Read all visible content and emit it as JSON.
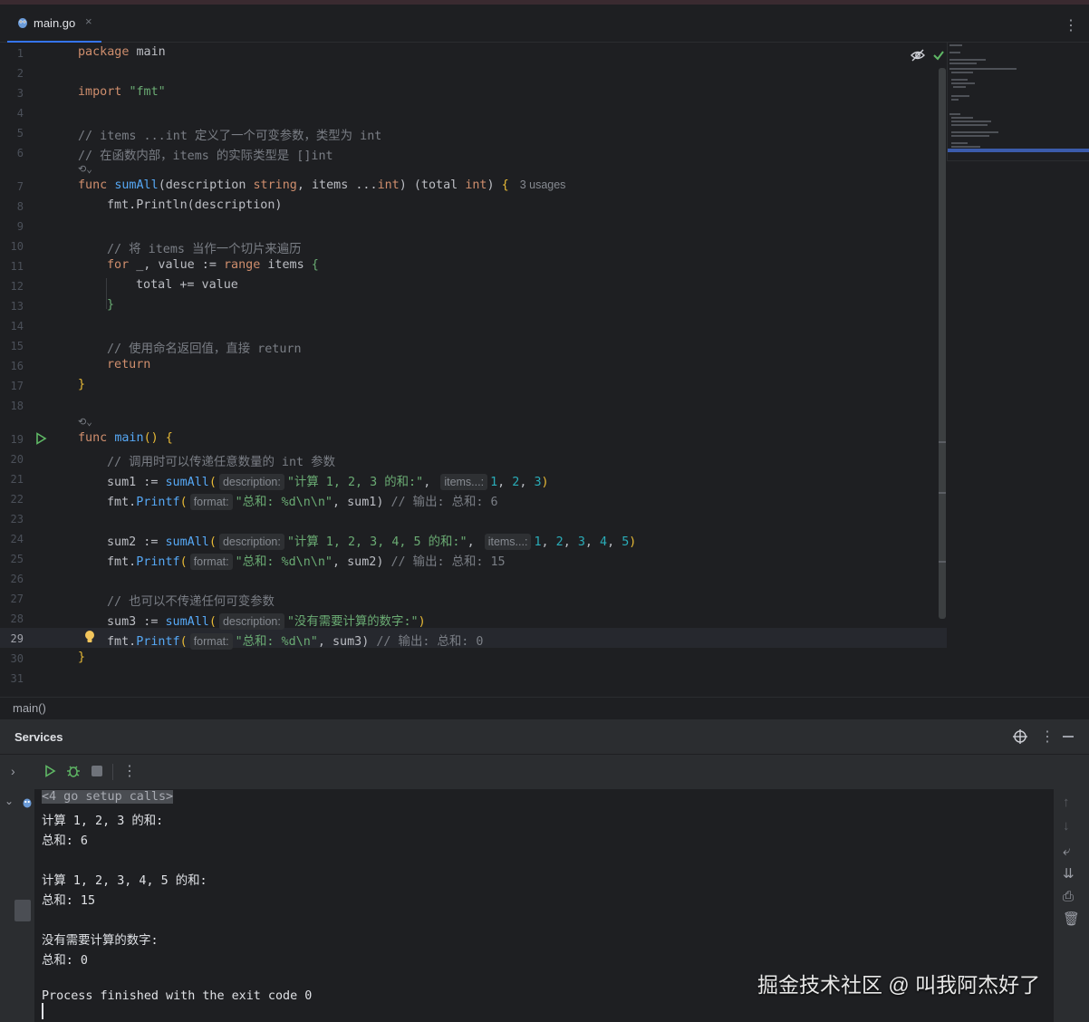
{
  "tab": {
    "filename": "main.go",
    "close": "×",
    "more": "⋮"
  },
  "editor": {
    "line_numbers": [
      "1",
      "2",
      "3",
      "4",
      "5",
      "6",
      "7",
      "8",
      "9",
      "10",
      "11",
      "12",
      "13",
      "14",
      "15",
      "16",
      "17",
      "18",
      "19",
      "20",
      "21",
      "22",
      "23",
      "24",
      "25",
      "26",
      "27",
      "28",
      "29",
      "30",
      "31"
    ],
    "current_line": "29",
    "l1": [
      "package",
      "main"
    ],
    "l3": [
      "import",
      "\"fmt\""
    ],
    "l5": "// items ...int 定义了一个可变参数，类型为 int",
    "l6": "// 在函数内部，items 的实际类型是 []int",
    "l7": {
      "func": "func",
      "name": "sumAll",
      "p1": "(description ",
      "t1": "string",
      "p2": ", items ...",
      "t2": "int",
      "p3": ") (total ",
      "t3": "int",
      "p4": ") ",
      "brace": "{",
      "usages": "3 usages"
    },
    "l8": "fmt.Println(description)",
    "l10": "// 将 items 当作一个切片来遍历",
    "l11": {
      "for": "for",
      "mid": " _, value := ",
      "range": "range",
      "rest": " items ",
      "brace": "{"
    },
    "l12": "total += value",
    "l13": "}",
    "l15": "// 使用命名返回值，直接 return",
    "l16": "return",
    "l17": "}",
    "l19": {
      "func": "func",
      "name": "main",
      "paren": "()",
      "brace": "{"
    },
    "l20": "// 调用时可以传递任意数量的 int 参数",
    "l21": {
      "lhs": "sum1 := ",
      "fn": "sumAll",
      "hint1": "description:",
      "str": "\"计算 1, 2, 3 的和:\"",
      "hint2": "items...:",
      "nums": [
        "1",
        "2",
        "3"
      ],
      "close": ")"
    },
    "l22": {
      "pkg": "fmt.",
      "fn": "Printf",
      "hint": "format:",
      "str": "\"总和: %d\\n\\n\"",
      "rest": ", sum1) ",
      "comment": "// 输出: 总和: 6"
    },
    "l24": {
      "lhs": "sum2 := ",
      "fn": "sumAll",
      "hint1": "description:",
      "str": "\"计算 1, 2, 3, 4, 5 的和:\"",
      "hint2": "items...:",
      "nums": [
        "1",
        "2",
        "3",
        "4",
        "5"
      ],
      "close": ")"
    },
    "l25": {
      "pkg": "fmt.",
      "fn": "Printf",
      "hint": "format:",
      "str": "\"总和: %d\\n\\n\"",
      "rest": ", sum2) ",
      "comment": "// 输出: 总和: 15"
    },
    "l27": "// 也可以不传递任何可变参数",
    "l28": {
      "lhs": "sum3 := ",
      "fn": "sumAll",
      "hint1": "description:",
      "str": "\"没有需要计算的数字:\"",
      "close": ")"
    },
    "l29": {
      "pkg": "fmt.",
      "fn": "Printf",
      "hint": "format:",
      "str": "\"总和: %d\\n\"",
      "rest": ", sum3) ",
      "comment": "// 输出: 总和: 0"
    },
    "l30": "}",
    "collapse_glyph": "⟲⌄"
  },
  "breadcrumb": "main()",
  "services": {
    "title": "Services",
    "more": "⋮",
    "output": {
      "setup_calls": "<4 go setup calls>",
      "lines": [
        "计算 1, 2, 3 的和:",
        "总和: 6",
        "",
        "计算 1, 2, 3, 4, 5 的和:",
        "总和: 15",
        "",
        "没有需要计算的数字:",
        "总和: 0",
        "",
        "Process finished with the exit code 0"
      ]
    }
  },
  "watermark": "掘金技术社区 @ 叫我阿杰好了",
  "colors": {
    "keyword": "#cf8e6d",
    "function": "#56a8f5",
    "string": "#6aab73",
    "comment": "#7a7e85",
    "number": "#2aacb8",
    "accent": "#3574f0"
  }
}
